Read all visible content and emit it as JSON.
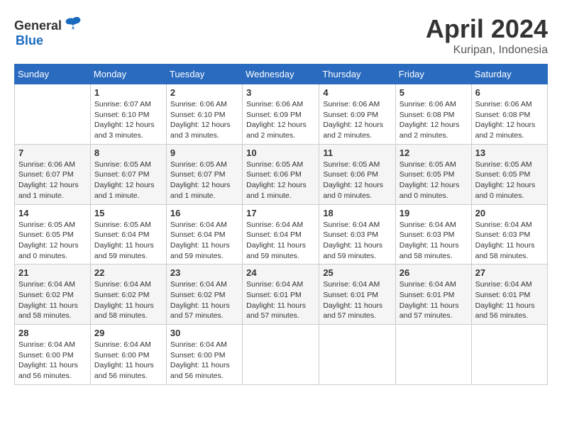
{
  "header": {
    "logo": {
      "general": "General",
      "blue": "Blue"
    },
    "title": "April 2024",
    "location": "Kuripan, Indonesia"
  },
  "weekdays": [
    "Sunday",
    "Monday",
    "Tuesday",
    "Wednesday",
    "Thursday",
    "Friday",
    "Saturday"
  ],
  "weeks": [
    [
      {
        "day": "",
        "info": ""
      },
      {
        "day": "1",
        "info": "Sunrise: 6:07 AM\nSunset: 6:10 PM\nDaylight: 12 hours\nand 3 minutes."
      },
      {
        "day": "2",
        "info": "Sunrise: 6:06 AM\nSunset: 6:10 PM\nDaylight: 12 hours\nand 3 minutes."
      },
      {
        "day": "3",
        "info": "Sunrise: 6:06 AM\nSunset: 6:09 PM\nDaylight: 12 hours\nand 2 minutes."
      },
      {
        "day": "4",
        "info": "Sunrise: 6:06 AM\nSunset: 6:09 PM\nDaylight: 12 hours\nand 2 minutes."
      },
      {
        "day": "5",
        "info": "Sunrise: 6:06 AM\nSunset: 6:08 PM\nDaylight: 12 hours\nand 2 minutes."
      },
      {
        "day": "6",
        "info": "Sunrise: 6:06 AM\nSunset: 6:08 PM\nDaylight: 12 hours\nand 2 minutes."
      }
    ],
    [
      {
        "day": "7",
        "info": "Sunrise: 6:06 AM\nSunset: 6:07 PM\nDaylight: 12 hours\nand 1 minute."
      },
      {
        "day": "8",
        "info": "Sunrise: 6:05 AM\nSunset: 6:07 PM\nDaylight: 12 hours\nand 1 minute."
      },
      {
        "day": "9",
        "info": "Sunrise: 6:05 AM\nSunset: 6:07 PM\nDaylight: 12 hours\nand 1 minute."
      },
      {
        "day": "10",
        "info": "Sunrise: 6:05 AM\nSunset: 6:06 PM\nDaylight: 12 hours\nand 1 minute."
      },
      {
        "day": "11",
        "info": "Sunrise: 6:05 AM\nSunset: 6:06 PM\nDaylight: 12 hours\nand 0 minutes."
      },
      {
        "day": "12",
        "info": "Sunrise: 6:05 AM\nSunset: 6:05 PM\nDaylight: 12 hours\nand 0 minutes."
      },
      {
        "day": "13",
        "info": "Sunrise: 6:05 AM\nSunset: 6:05 PM\nDaylight: 12 hours\nand 0 minutes."
      }
    ],
    [
      {
        "day": "14",
        "info": "Sunrise: 6:05 AM\nSunset: 6:05 PM\nDaylight: 12 hours\nand 0 minutes."
      },
      {
        "day": "15",
        "info": "Sunrise: 6:05 AM\nSunset: 6:04 PM\nDaylight: 11 hours\nand 59 minutes."
      },
      {
        "day": "16",
        "info": "Sunrise: 6:04 AM\nSunset: 6:04 PM\nDaylight: 11 hours\nand 59 minutes."
      },
      {
        "day": "17",
        "info": "Sunrise: 6:04 AM\nSunset: 6:04 PM\nDaylight: 11 hours\nand 59 minutes."
      },
      {
        "day": "18",
        "info": "Sunrise: 6:04 AM\nSunset: 6:03 PM\nDaylight: 11 hours\nand 59 minutes."
      },
      {
        "day": "19",
        "info": "Sunrise: 6:04 AM\nSunset: 6:03 PM\nDaylight: 11 hours\nand 58 minutes."
      },
      {
        "day": "20",
        "info": "Sunrise: 6:04 AM\nSunset: 6:03 PM\nDaylight: 11 hours\nand 58 minutes."
      }
    ],
    [
      {
        "day": "21",
        "info": "Sunrise: 6:04 AM\nSunset: 6:02 PM\nDaylight: 11 hours\nand 58 minutes."
      },
      {
        "day": "22",
        "info": "Sunrise: 6:04 AM\nSunset: 6:02 PM\nDaylight: 11 hours\nand 58 minutes."
      },
      {
        "day": "23",
        "info": "Sunrise: 6:04 AM\nSunset: 6:02 PM\nDaylight: 11 hours\nand 57 minutes."
      },
      {
        "day": "24",
        "info": "Sunrise: 6:04 AM\nSunset: 6:01 PM\nDaylight: 11 hours\nand 57 minutes."
      },
      {
        "day": "25",
        "info": "Sunrise: 6:04 AM\nSunset: 6:01 PM\nDaylight: 11 hours\nand 57 minutes."
      },
      {
        "day": "26",
        "info": "Sunrise: 6:04 AM\nSunset: 6:01 PM\nDaylight: 11 hours\nand 57 minutes."
      },
      {
        "day": "27",
        "info": "Sunrise: 6:04 AM\nSunset: 6:01 PM\nDaylight: 11 hours\nand 56 minutes."
      }
    ],
    [
      {
        "day": "28",
        "info": "Sunrise: 6:04 AM\nSunset: 6:00 PM\nDaylight: 11 hours\nand 56 minutes."
      },
      {
        "day": "29",
        "info": "Sunrise: 6:04 AM\nSunset: 6:00 PM\nDaylight: 11 hours\nand 56 minutes."
      },
      {
        "day": "30",
        "info": "Sunrise: 6:04 AM\nSunset: 6:00 PM\nDaylight: 11 hours\nand 56 minutes."
      },
      {
        "day": "",
        "info": ""
      },
      {
        "day": "",
        "info": ""
      },
      {
        "day": "",
        "info": ""
      },
      {
        "day": "",
        "info": ""
      }
    ]
  ]
}
